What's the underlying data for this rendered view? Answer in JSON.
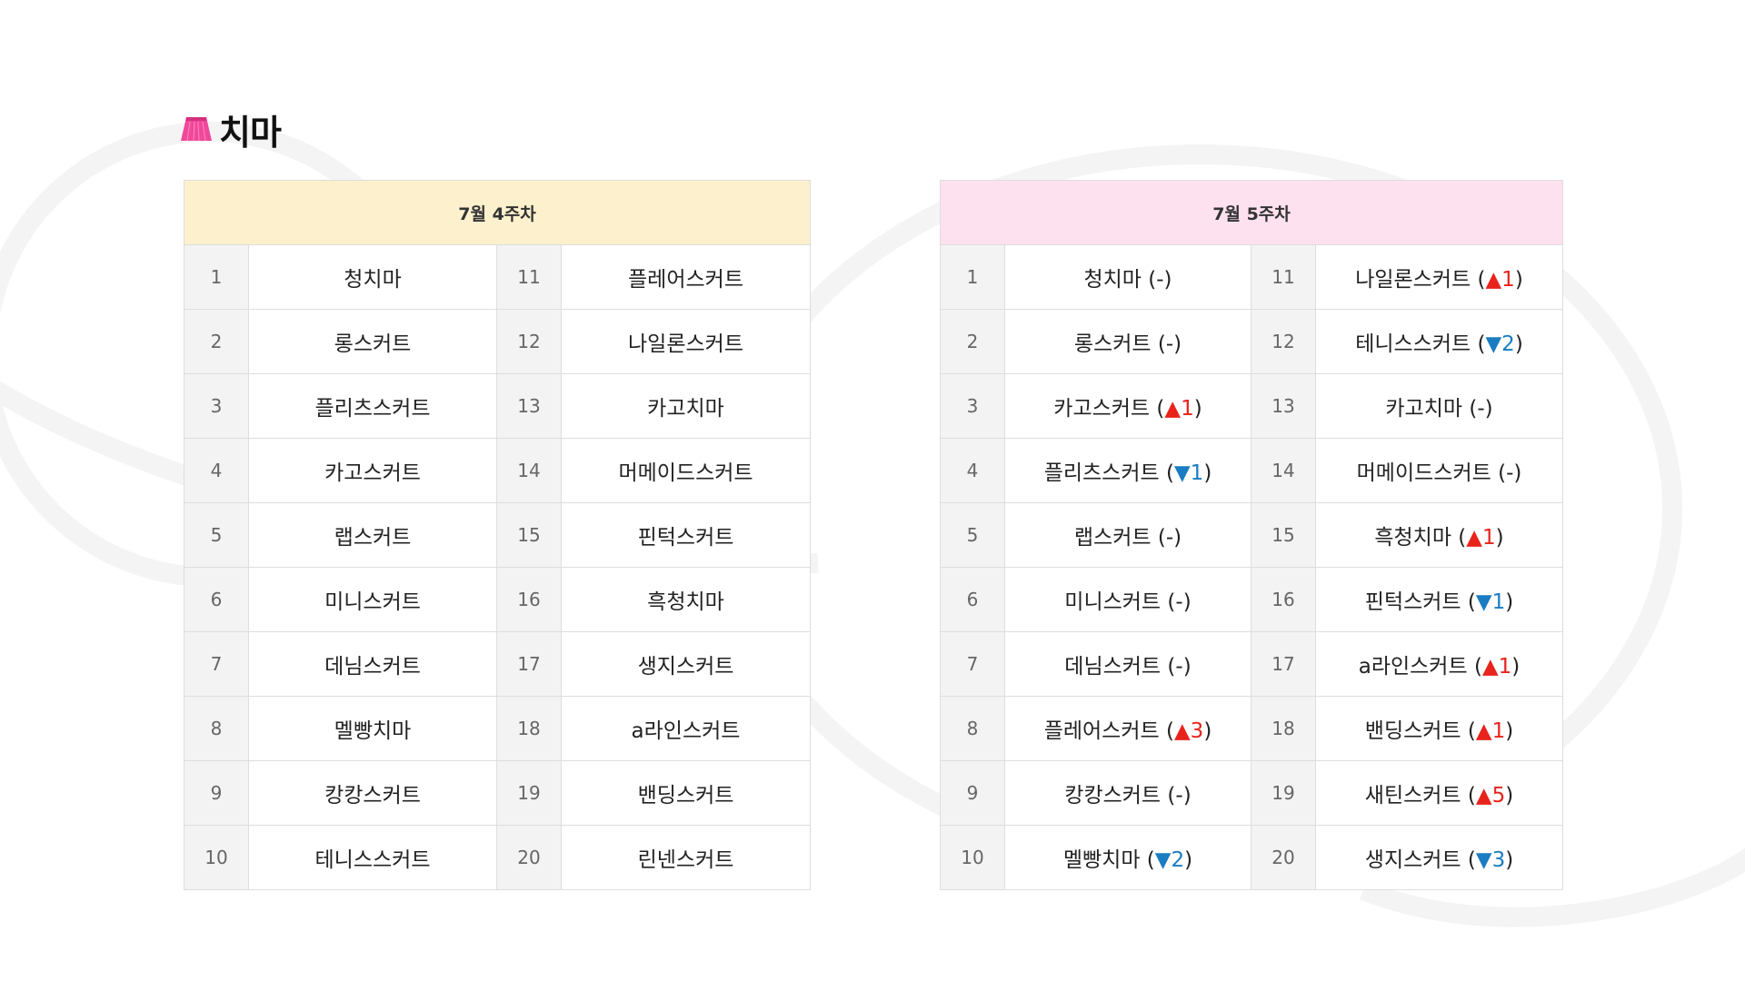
{
  "page": {
    "title": "치마"
  },
  "colors": {
    "accent_icon": "#f0489a",
    "header_week4": "#fdf0cd",
    "header_week5": "#fde1ef",
    "up": "#e8231c",
    "down": "#1a7cc2"
  },
  "icons": {
    "title_icon": "skirt-icon"
  },
  "week4": {
    "header": "7월 4주차",
    "rows": [
      {
        "rank_a": "1",
        "name_a": "청치마",
        "rank_b": "11",
        "name_b": "플레어스커트"
      },
      {
        "rank_a": "2",
        "name_a": "롱스커트",
        "rank_b": "12",
        "name_b": "나일론스커트"
      },
      {
        "rank_a": "3",
        "name_a": "플리츠스커트",
        "rank_b": "13",
        "name_b": "카고치마"
      },
      {
        "rank_a": "4",
        "name_a": "카고스커트",
        "rank_b": "14",
        "name_b": "머메이드스커트"
      },
      {
        "rank_a": "5",
        "name_a": "랩스커트",
        "rank_b": "15",
        "name_b": "핀턱스커트"
      },
      {
        "rank_a": "6",
        "name_a": "미니스커트",
        "rank_b": "16",
        "name_b": "흑청치마"
      },
      {
        "rank_a": "7",
        "name_a": "데님스커트",
        "rank_b": "17",
        "name_b": "생지스커트"
      },
      {
        "rank_a": "8",
        "name_a": "멜빵치마",
        "rank_b": "18",
        "name_b": "a라인스커트"
      },
      {
        "rank_a": "9",
        "name_a": "캉캉스커트",
        "rank_b": "19",
        "name_b": "밴딩스커트"
      },
      {
        "rank_a": "10",
        "name_a": "테니스스커트",
        "rank_b": "20",
        "name_b": "린넨스커트"
      }
    ]
  },
  "week5": {
    "header": "7월 5주차",
    "rows": [
      {
        "rank_a": "1",
        "name_a": "청치마",
        "chg_a": {
          "dir": "none",
          "sym": "",
          "num": "-"
        },
        "rank_b": "11",
        "name_b": "나일론스커트",
        "chg_b": {
          "dir": "up",
          "sym": "▲",
          "num": "1"
        }
      },
      {
        "rank_a": "2",
        "name_a": "롱스커트",
        "chg_a": {
          "dir": "none",
          "sym": "",
          "num": "-"
        },
        "rank_b": "12",
        "name_b": "테니스스커트",
        "chg_b": {
          "dir": "down",
          "sym": "▼",
          "num": "2"
        }
      },
      {
        "rank_a": "3",
        "name_a": "카고스커트",
        "chg_a": {
          "dir": "up",
          "sym": "▲",
          "num": "1"
        },
        "rank_b": "13",
        "name_b": "카고치마",
        "chg_b": {
          "dir": "none",
          "sym": "",
          "num": "-"
        }
      },
      {
        "rank_a": "4",
        "name_a": "플리츠스커트",
        "chg_a": {
          "dir": "down",
          "sym": "▼",
          "num": "1"
        },
        "rank_b": "14",
        "name_b": "머메이드스커트",
        "chg_b": {
          "dir": "none",
          "sym": "",
          "num": "-"
        }
      },
      {
        "rank_a": "5",
        "name_a": "랩스커트",
        "chg_a": {
          "dir": "none",
          "sym": "",
          "num": "-"
        },
        "rank_b": "15",
        "name_b": "흑청치마",
        "chg_b": {
          "dir": "up",
          "sym": "▲",
          "num": "1"
        }
      },
      {
        "rank_a": "6",
        "name_a": "미니스커트",
        "chg_a": {
          "dir": "none",
          "sym": "",
          "num": "-"
        },
        "rank_b": "16",
        "name_b": "핀턱스커트",
        "chg_b": {
          "dir": "down",
          "sym": "▼",
          "num": "1"
        }
      },
      {
        "rank_a": "7",
        "name_a": "데님스커트",
        "chg_a": {
          "dir": "none",
          "sym": "",
          "num": "-"
        },
        "rank_b": "17",
        "name_b": "a라인스커트",
        "chg_b": {
          "dir": "up",
          "sym": "▲",
          "num": "1"
        }
      },
      {
        "rank_a": "8",
        "name_a": "플레어스커트",
        "chg_a": {
          "dir": "up",
          "sym": "▲",
          "num": "3"
        },
        "rank_b": "18",
        "name_b": "밴딩스커트",
        "chg_b": {
          "dir": "up",
          "sym": "▲",
          "num": "1"
        }
      },
      {
        "rank_a": "9",
        "name_a": "캉캉스커트",
        "chg_a": {
          "dir": "none",
          "sym": "",
          "num": "-"
        },
        "rank_b": "19",
        "name_b": "새틴스커트",
        "chg_b": {
          "dir": "up",
          "sym": "▲",
          "num": "5"
        }
      },
      {
        "rank_a": "10",
        "name_a": "멜빵치마",
        "chg_a": {
          "dir": "down",
          "sym": "▼",
          "num": "2"
        },
        "rank_b": "20",
        "name_b": "생지스커트",
        "chg_b": {
          "dir": "down",
          "sym": "▼",
          "num": "3"
        }
      }
    ]
  }
}
